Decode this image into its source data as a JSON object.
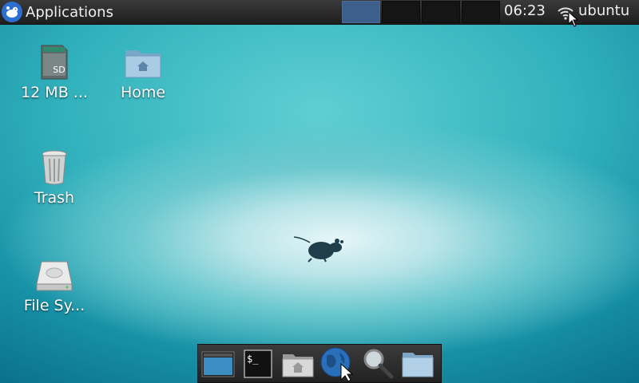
{
  "panel": {
    "app_menu_label": "Applications",
    "clock": "06:23",
    "user": "ubuntu",
    "workspaces": 4,
    "active_workspace": 1
  },
  "desktop": {
    "icons": [
      {
        "label": "12 MB ...",
        "icon": "sd-card-icon"
      },
      {
        "label": "Home",
        "icon": "home-folder-icon"
      },
      {
        "label": "Trash",
        "icon": "trash-icon"
      },
      {
        "label": "File Sy...",
        "icon": "hard-drive-icon"
      }
    ],
    "sd_badge": "SD"
  },
  "dock": {
    "launchers": [
      "show-desktop-icon",
      "terminal-icon",
      "home-folder-icon",
      "web-browser-icon",
      "search-icon",
      "folder-icon"
    ],
    "terminal_glyph": "$_"
  },
  "colors": {
    "panel": "#2a2a2a",
    "active_workspace": "#3c5f8c",
    "desktop_teal": "#2fb0bb",
    "xfce_blue": "#2d6fcf"
  }
}
